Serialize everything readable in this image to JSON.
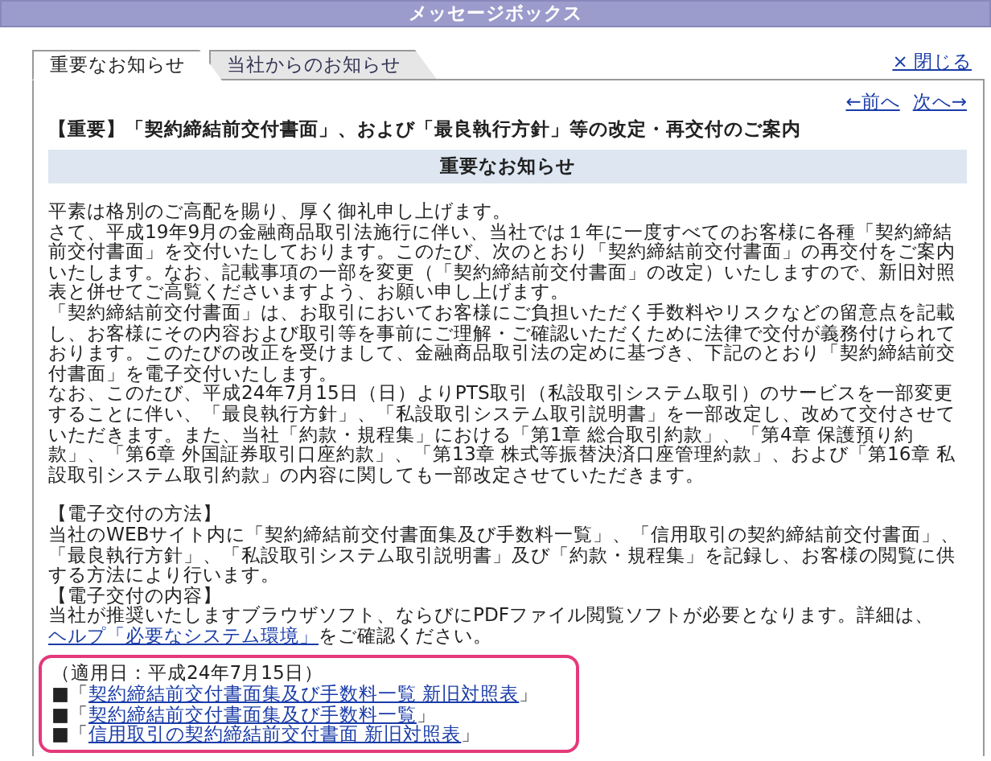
{
  "window": {
    "title": "メッセージボックス"
  },
  "tabs": [
    {
      "label": "重要なお知らせ",
      "selected": true
    },
    {
      "label": "当社からのお知らせ",
      "selected": false
    }
  ],
  "close_link": "× 閉じる",
  "nav": {
    "prev": "←前へ",
    "next": "次へ→"
  },
  "message": {
    "subject": "【重要】「契約締結前交付書面」、および「最良執行方針」等の改定・再交付のご案内",
    "header": "重要なお知らせ",
    "paragraphs": [
      "平素は格別のご高配を賜り、厚く御礼申し上げます。",
      "さて、平成19年9月の金融商品取引法施行に伴い、当社では１年に一度すべてのお客様に各種「契約締結前交付書面」を交付いたしております。このたび、次のとおり「契約締結前交付書面」の再交付をご案内いたします。なお、記載事項の一部を変更（「契約締結前交付書面」の改定）いたしますので、新旧対照表と併せてご高覧くださいますよう、お願い申し上げます。",
      "「契約締結前交付書面」は、お取引においてお客様にご負担いただく手数料やリスクなどの留意点を記載し、お客様にその内容および取引等を事前にご理解・ご確認いただくために法律で交付が義務付けられております。このたびの改正を受けまして、金融商品取引法の定めに基づき、下記のとおり「契約締結前交付書面」を電子交付いたします。",
      "なお、このたび、平成24年7月15日（日）よりPTS取引（私設取引システム取引）のサービスを一部変更することに伴い、「最良執行方針」、「私設取引システム取引説明書」を一部改定し、改めて交付させていただきます。また、当社「約款・規程集」における「第1章 総合取引約款」、「第4章 保護預り約款」、「第6章 外国証券取引口座約款」、「第13章 株式等振替決済口座管理約款」、および「第16章 私設取引システム取引約款」の内容に関しても一部改定させていただきます。"
    ],
    "method": {
      "heading": "【電子交付の方法】",
      "text": "当社のWEBサイト内に「契約締結前交付書面集及び手数料一覧」、「信用取引の契約締結前交付書面」、「最良執行方針」、「私設取引システム取引説明書」及び「約款・規程集」を記録し、お客様の閲覧に供する方法により行います。"
    },
    "contents": {
      "heading": "【電子交付の内容】",
      "text": "当社が推奨いたしますブラウザソフト、ならびにPDFファイル閲覧ソフトが必要となります。詳細は、",
      "link": "ヘルプ「必要なシステム環境」",
      "text_after": "をご確認ください。"
    },
    "documents": {
      "effective_date": "（適用日：平成24年7月15日）",
      "links": [
        {
          "prefix": "■「",
          "label": "契約締結前交付書面集及び手数料一覧  新旧対照表",
          "suffix": "」"
        },
        {
          "prefix": "■「",
          "label": "契約締結前交付書面集及び手数料一覧",
          "suffix": "」"
        },
        {
          "prefix": "■「",
          "label": "信用取引の契約締結前交付書面  新旧対照表",
          "suffix": "」"
        }
      ]
    }
  }
}
